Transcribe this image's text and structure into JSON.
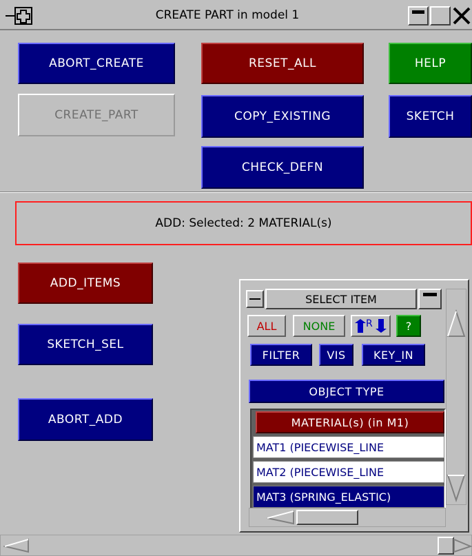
{
  "window": {
    "title": "CREATE PART in model 1"
  },
  "buttons": {
    "abort_create": "ABORT_CREATE",
    "reset_all": "RESET_ALL",
    "help": "HELP",
    "create_part": "CREATE_PART",
    "copy_existing": "COPY_EXISTING",
    "sketch": "SKETCH",
    "check_defn": "CHECK_DEFN",
    "add_items": "ADD_ITEMS",
    "sketch_sel": "SKETCH_SEL",
    "abort_add": "ABORT_ADD"
  },
  "status": {
    "text": "ADD: Selected: 2 MATERIAL(s)"
  },
  "select_panel": {
    "title": "SELECT ITEM",
    "all": "ALL",
    "none": "NONE",
    "reverse": "R",
    "help": "?",
    "filter": "FILTER",
    "vis": "VIS",
    "key_in": "KEY_IN",
    "object_type": "OBJECT TYPE",
    "list_header": "MATERIAL(s) (in M1)",
    "items": [
      {
        "label": "MAT1 (PIECEWISE_LINE",
        "selected": false
      },
      {
        "label": "MAT2 (PIECEWISE_LINE",
        "selected": false
      },
      {
        "label": "MAT3 (SPRING_ELASTIC)",
        "selected": true
      }
    ]
  },
  "colors": {
    "blue": "#000080",
    "red": "#800000",
    "green": "#008000",
    "gray": "#c0c0c0"
  }
}
